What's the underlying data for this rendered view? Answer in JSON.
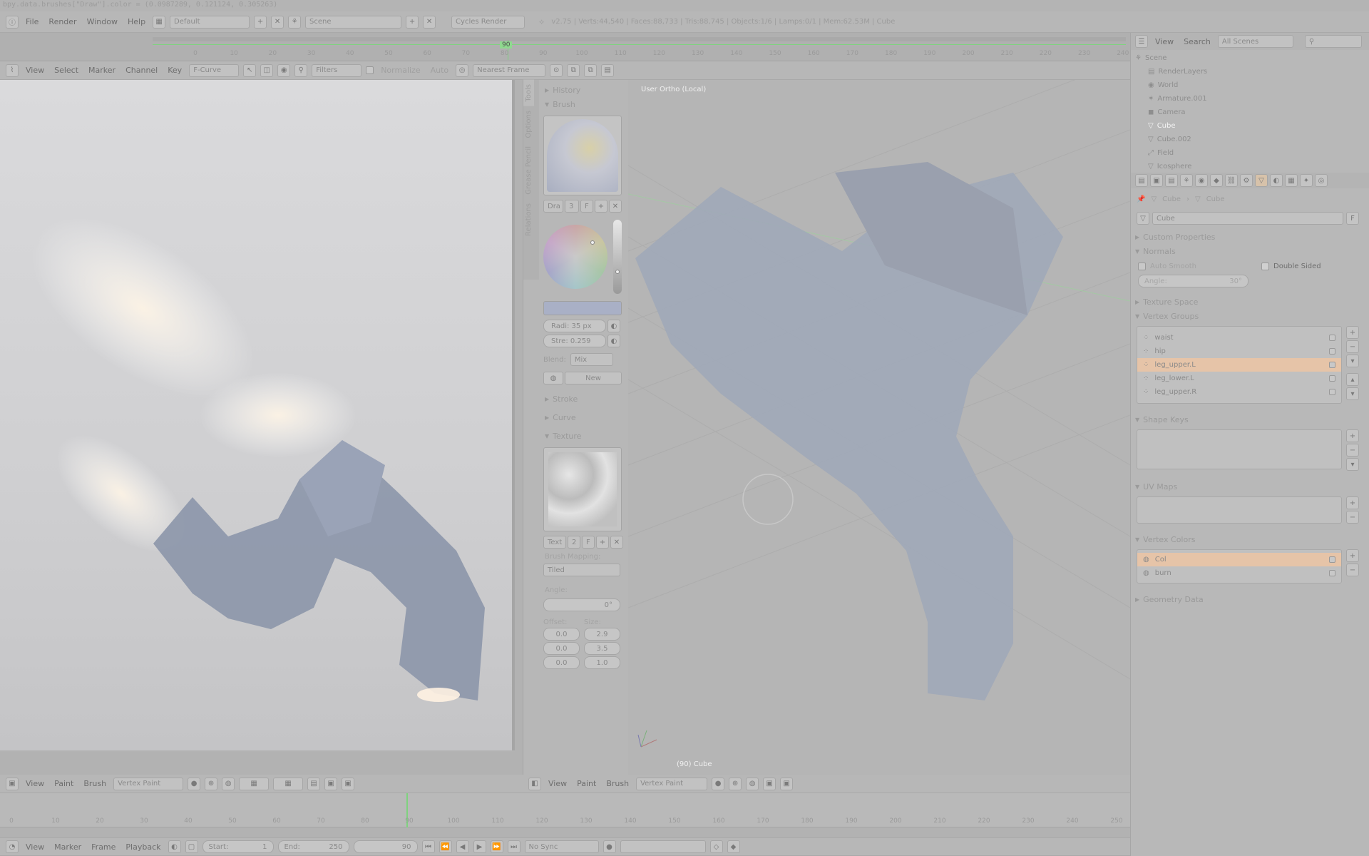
{
  "python_line": "bpy.data.brushes[\"Draw\"].color = (0.0987289, 0.121124, 0.305263)",
  "topbar": {
    "menus": [
      "File",
      "Render",
      "Window",
      "Help"
    ],
    "layout": "Default",
    "scene": "Scene",
    "engine": "Cycles Render",
    "stats": "v2.75 | Verts:44,540 | Faces:88,733 | Tris:88,745 | Objects:1/6 | Lamps:0/1 | Mem:62.53M | Cube"
  },
  "graph_editor": {
    "current_frame": "90",
    "ruler_ticks": [
      "0",
      "10",
      "20",
      "30",
      "40",
      "50",
      "60",
      "70",
      "80",
      "90",
      "100",
      "110",
      "120",
      "130",
      "140",
      "150",
      "160",
      "170",
      "180",
      "190",
      "200",
      "210",
      "220",
      "230",
      "240"
    ],
    "menus": [
      "View",
      "Select",
      "Marker",
      "Channel",
      "Key"
    ],
    "mode": "F-Curve",
    "filters_label": "Filters",
    "normalize_label": "Normalize",
    "auto_label": "Auto",
    "snap": "Nearest Frame"
  },
  "image_editor": {
    "menus": [
      "View",
      "Paint",
      "Brush"
    ],
    "mode": "Vertex Paint"
  },
  "tool_shelf": {
    "tabs": [
      "Tools",
      "Options",
      "Grease Pencil",
      "Relations"
    ],
    "history_label": "History",
    "brush_label": "Brush",
    "brush_name": "Dra",
    "brush_users": "3",
    "brush_f": "F",
    "radius": "Radi: 35 px",
    "strength": "Stre: 0.259",
    "blend_label": "Blend:",
    "blend_value": "Mix",
    "new_label": "New",
    "stroke_label": "Stroke",
    "curve_label": "Curve",
    "texture_label": "Texture",
    "texture_name": "Text",
    "texture_users": "2",
    "texture_f": "F",
    "brush_mapping_label": "Brush Mapping:",
    "brush_mapping_value": "Tiled",
    "angle_label": "Angle:",
    "angle_value": "0°",
    "offset_label": "Offset:",
    "size_label": "Size:",
    "offset_values": [
      "0.0",
      "0.0",
      "0.0"
    ],
    "size_values": [
      "2.9",
      "3.5",
      "1.0"
    ]
  },
  "viewport": {
    "view_label": "User Ortho (Local)",
    "object_label": "(90) Cube",
    "menus": [
      "View",
      "Paint",
      "Brush"
    ],
    "mode": "Vertex Paint"
  },
  "outliner": {
    "menus": [
      "View",
      "Search"
    ],
    "scope": "All Scenes",
    "items": [
      "Scene",
      "RenderLayers",
      "World",
      "Armature.001",
      "Camera",
      "Cube",
      "Cube.002",
      "Field",
      "Icosphere"
    ]
  },
  "properties": {
    "breadcrumb": [
      "Cube",
      "Cube"
    ],
    "mesh_name": "Cube",
    "panels": {
      "custom_properties": "Custom Properties",
      "normals": "Normals",
      "auto_smooth": "Auto Smooth",
      "double_sided": "Double Sided",
      "angle": "Angle:",
      "angle_value": "30°",
      "texture_space": "Texture Space",
      "vertex_groups": "Vertex Groups",
      "shape_keys": "Shape Keys",
      "uv_maps": "UV Maps",
      "vertex_colors": "Vertex Colors",
      "geometry_data": "Geometry Data"
    },
    "vertex_groups": [
      "waist",
      "hip",
      "leg_upper.L",
      "leg_lower.L",
      "leg_upper.R"
    ],
    "vertex_group_selected": 2,
    "vertex_colors": [
      "Col",
      "burn"
    ],
    "vertex_color_selected": 0
  },
  "timeline": {
    "ticks": [
      "0",
      "10",
      "20",
      "30",
      "40",
      "50",
      "60",
      "70",
      "80",
      "90",
      "100",
      "110",
      "120",
      "130",
      "140",
      "150",
      "160",
      "170",
      "180",
      "190",
      "200",
      "210",
      "220",
      "230",
      "240",
      "250"
    ],
    "menus": [
      "View",
      "Marker",
      "Frame",
      "Playback"
    ],
    "start_label": "Start:",
    "start": "1",
    "end_label": "End:",
    "end": "250",
    "current": "90",
    "sync": "No Sync"
  },
  "colors": {
    "accent_selected": "#e6c4a8",
    "frame_marker": "#7fd27f"
  }
}
